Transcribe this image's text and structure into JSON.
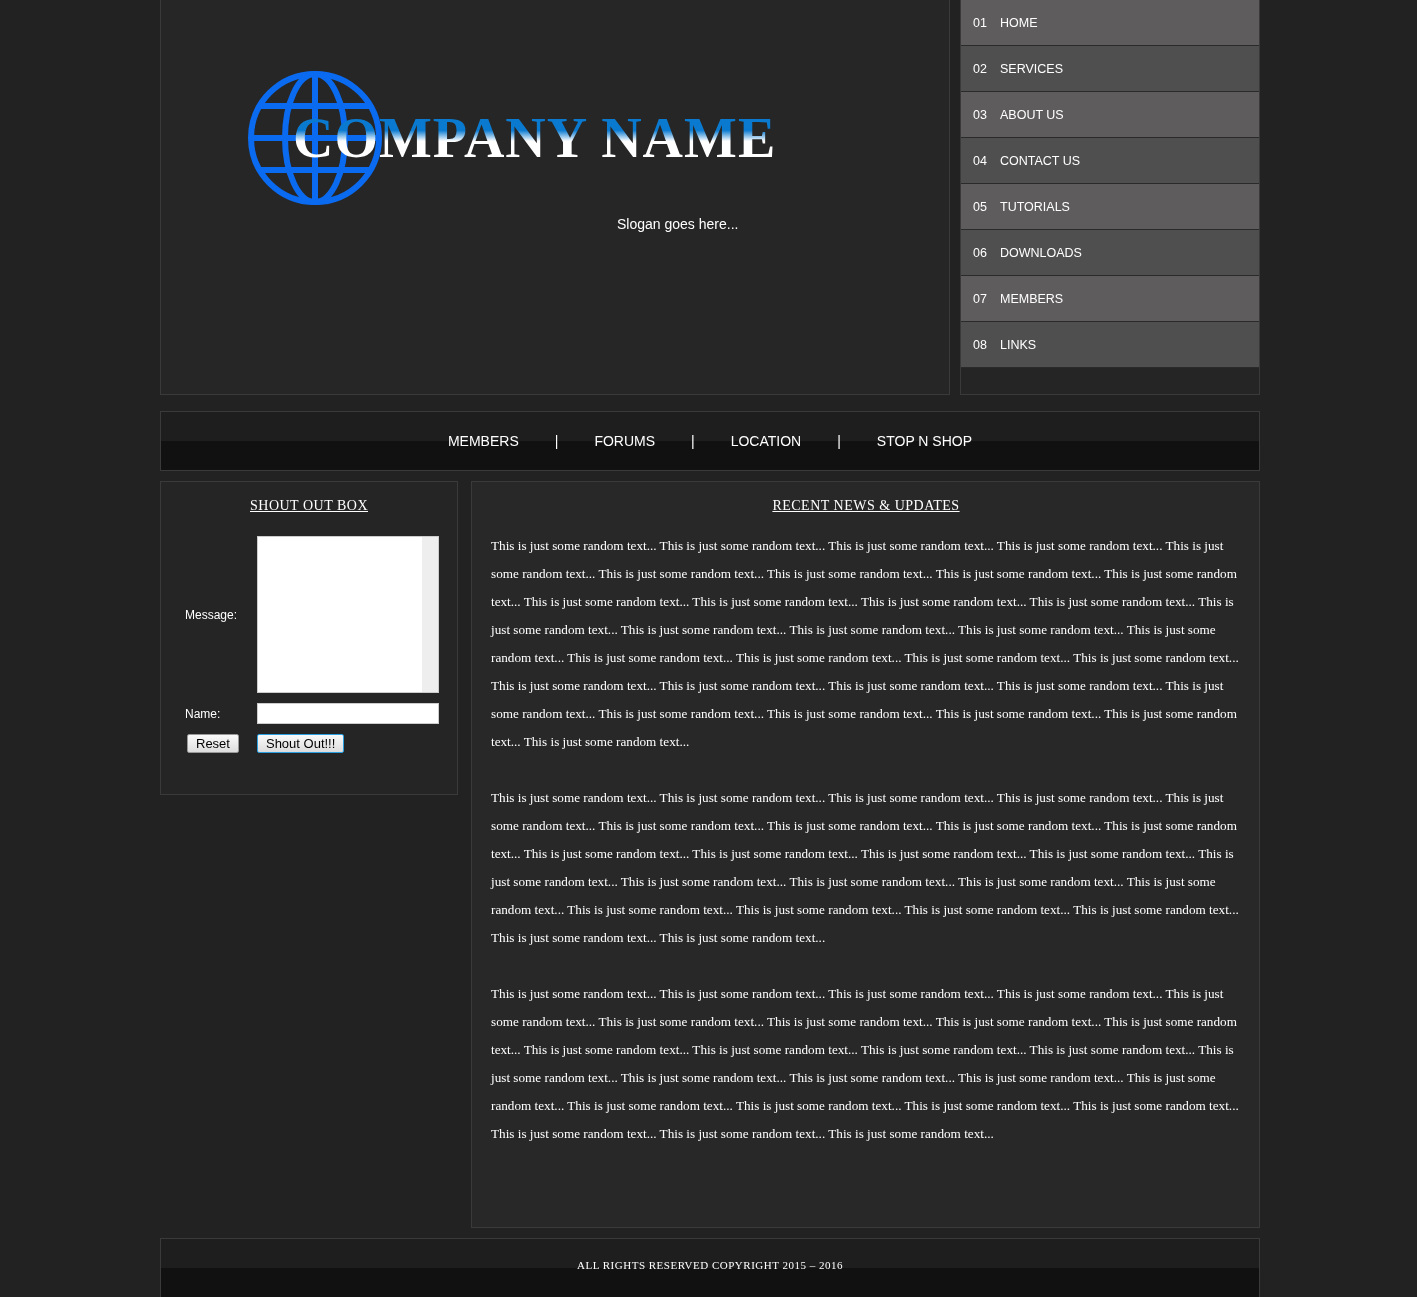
{
  "header": {
    "company_name": "COMPANY NAME",
    "slogan": "Slogan goes here..."
  },
  "side_menu": [
    {
      "number": "01",
      "label": "HOME"
    },
    {
      "number": "02",
      "label": "SERVICES"
    },
    {
      "number": "03",
      "label": "ABOUT US"
    },
    {
      "number": "04",
      "label": "CONTACT US"
    },
    {
      "number": "05",
      "label": "TUTORIALS"
    },
    {
      "number": "06",
      "label": "DOWNLOADS"
    },
    {
      "number": "07",
      "label": "MEMBERS"
    },
    {
      "number": "08",
      "label": "LINKS"
    }
  ],
  "nav": {
    "links": [
      "MEMBERS",
      "FORUMS",
      "LOCATION",
      "STOP N SHOP"
    ],
    "separator": "|"
  },
  "shout_box": {
    "title": "SHOUT OUT BOX",
    "message_label": "Message:",
    "name_label": "Name:",
    "buttons": [
      "Reset",
      "Shout Out!!!"
    ]
  },
  "news": {
    "title": "RECENT NEWS & UPDATES",
    "paragraphs": [
      "This is just some random text... This is just some random text... This is just some random text... This is just some random text... This is just some random text... This is just some random text... This is just some random text... This is just some random text... This is just some random text... This is just some random text... This is just some random text... This is just some random text... This is just some random text... This is just some random text... This is just some random text... This is just some random text... This is just some random text... This is just some random text... This is just some random text... This is just some random text... This is just some random text... This is just some random text... This is just some random text... This is just some random text... This is just some random text... This is just some random text... This is just some random text... This is just some random text... This is just some random text... This is just some random text... This is just some random text... This is just some random text...",
      "This is just some random text... This is just some random text... This is just some random text... This is just some random text... This is just some random text... This is just some random text... This is just some random text... This is just some random text... This is just some random text... This is just some random text... This is just some random text... This is just some random text... This is just some random text... This is just some random text... This is just some random text... This is just some random text... This is just some random text... This is just some random text... This is just some random text... This is just some random text... This is just some random text... This is just some random text... This is just some random text... This is just some random text...",
      "This is just some random text... This is just some random text... This is just some random text... This is just some random text... This is just some random text... This is just some random text... This is just some random text... This is just some random text... This is just some random text... This is just some random text... This is just some random text... This is just some random text... This is just some random text... This is just some random text... This is just some random text... This is just some random text... This is just some random text... This is just some random text... This is just some random text... This is just some random text... This is just some random text... This is just some random text... This is just some random text... This is just some random text... This is just some random text..."
    ]
  },
  "footer": {
    "copyright": "ALL RIGHTS RESERVED COPYRIGHT 2015 – 2016"
  }
}
